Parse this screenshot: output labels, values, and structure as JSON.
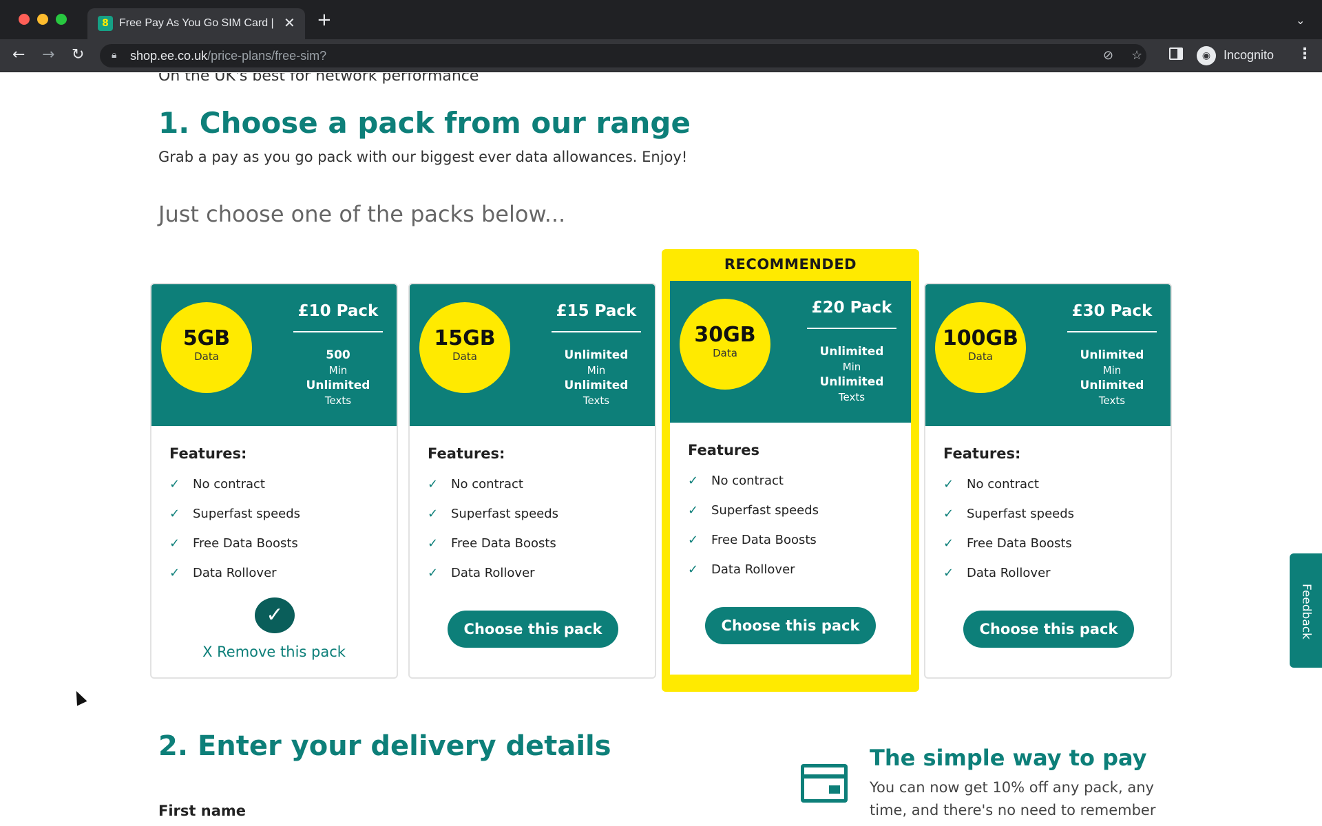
{
  "browser": {
    "tab_title": "Free Pay As You Go SIM Card |",
    "tab_close": "✕",
    "new_tab": "+",
    "tab_menu": "⌄",
    "url_host": "shop.ee.co.uk",
    "url_path": "/price-plans/free-sim?",
    "profile_label": "Incognito"
  },
  "page": {
    "intro": "On the UK's best for network performance",
    "heading1": "1. Choose a pack from our range",
    "subtext": "Grab a pay as you go pack with our biggest ever data allowances. Enjoy!",
    "prompt": "Just choose one of the packs below...",
    "recommended_label": "RECOMMENDED",
    "packs": [
      {
        "data": "5GB",
        "data_label": "Data",
        "name": "£10 Pack",
        "minutes": "500",
        "minutes_label": "Min",
        "texts": "Unlimited",
        "texts_label": "Texts",
        "features_title": "Features:",
        "features": [
          "No contract",
          "Superfast speeds",
          "Free Data Boosts",
          "Data Rollover"
        ],
        "selected": true,
        "remove_label": "X Remove this pack"
      },
      {
        "data": "15GB",
        "data_label": "Data",
        "name": "£15 Pack",
        "minutes": "Unlimited",
        "minutes_label": "Min",
        "texts": "Unlimited",
        "texts_label": "Texts",
        "features_title": "Features:",
        "features": [
          "No contract",
          "Superfast speeds",
          "Free Data Boosts",
          "Data Rollover"
        ],
        "button": "Choose this pack"
      },
      {
        "data": "30GB",
        "data_label": "Data",
        "name": "£20 Pack",
        "minutes": "Unlimited",
        "minutes_label": "Min",
        "texts": "Unlimited",
        "texts_label": "Texts",
        "features_title": "Features",
        "features": [
          "No contract",
          "Superfast speeds",
          "Free Data Boosts",
          "Data Rollover"
        ],
        "button": "Choose this pack",
        "recommended": true
      },
      {
        "data": "100GB",
        "data_label": "Data",
        "name": "£30 Pack",
        "minutes": "Unlimited",
        "minutes_label": "Min",
        "texts": "Unlimited",
        "texts_label": "Texts",
        "features_title": "Features:",
        "features": [
          "No contract",
          "Superfast speeds",
          "Free Data Boosts",
          "Data Rollover"
        ],
        "button": "Choose this pack"
      }
    ],
    "heading2": "2. Enter your delivery details",
    "first_name_label": "First name",
    "pay_title": "The simple way to pay",
    "pay_text": "You can now get 10% off any pack, any time, and there's no need to remember",
    "feedback_label": "Feedback"
  },
  "colors": {
    "brand_teal": "#0d7f79",
    "brand_yellow": "#ffea00"
  },
  "icons": [
    "back-arrow-icon",
    "forward-arrow-icon",
    "reload-icon",
    "lock-icon",
    "eye-off-icon",
    "star-icon",
    "side-panel-icon",
    "incognito-icon",
    "more-menu-icon",
    "check-icon",
    "credit-card-icon"
  ]
}
